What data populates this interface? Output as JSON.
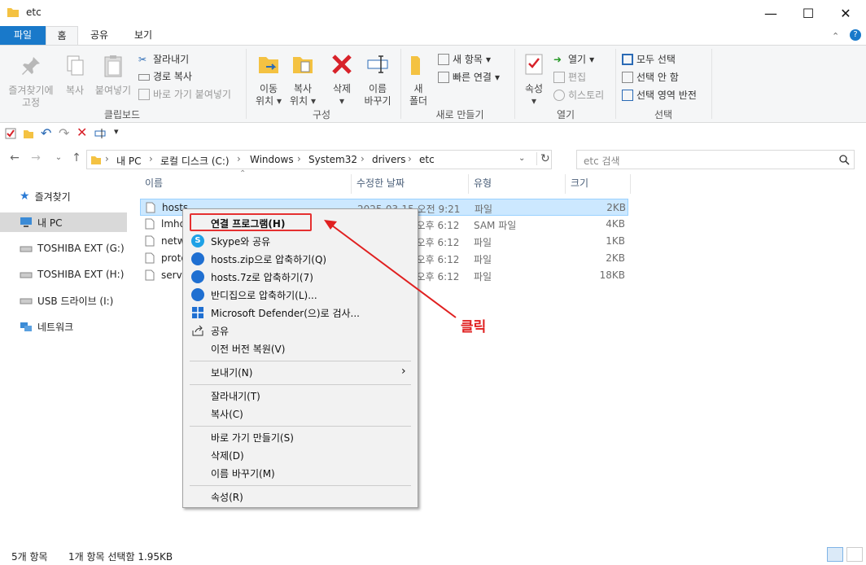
{
  "window": {
    "title": "etc"
  },
  "tabs": [
    {
      "label": "파일"
    },
    {
      "label": "홈"
    },
    {
      "label": "공유"
    },
    {
      "label": "보기"
    }
  ],
  "ribbon": {
    "clipboard": {
      "pin_label_1": "즐겨찾기에",
      "pin_label_2": "고정",
      "copy_label": "복사",
      "paste_label": "붙여넣기",
      "cut_label": "잘라내기",
      "copy_path_label": "경로 복사",
      "paste_shortcut_label": "바로 가기 붙여넣기",
      "group_label": "클립보드"
    },
    "organize": {
      "move_1": "이동",
      "move_2": "위치",
      "copyto_1": "복사",
      "copyto_2": "위치",
      "delete_label": "삭제",
      "rename_1": "이름",
      "rename_2": "바꾸기",
      "group_label": "구성"
    },
    "new": {
      "folder_1": "새",
      "folder_2": "폴더",
      "new_item_label": "새 항목",
      "easy_access_label": "빠른 연결",
      "group_label": "새로 만들기"
    },
    "open": {
      "properties_label": "속성",
      "open_label": "열기",
      "edit_label": "편집",
      "history_label": "히스토리",
      "group_label": "열기"
    },
    "select": {
      "select_all_label": "모두 선택",
      "select_none_label": "선택 안 함",
      "invert_label": "선택 영역 반전",
      "group_label": "선택"
    }
  },
  "address": {
    "crumbs": [
      "내 PC",
      "로컬 디스크 (C:)",
      "Windows",
      "System32",
      "drivers",
      "etc"
    ],
    "search_placeholder": "etc 검색"
  },
  "nav_pane": [
    {
      "label": "즐겨찾기"
    },
    {
      "label": "내 PC"
    },
    {
      "label": "TOSHIBA EXT (G:)"
    },
    {
      "label": "TOSHIBA EXT (H:)"
    },
    {
      "label": "USB 드라이브 (I:)"
    },
    {
      "label": "네트워크"
    }
  ],
  "columns": {
    "name": "이름",
    "date": "수정한 날짜",
    "type": "유형",
    "size": "크기"
  },
  "files": [
    {
      "name": "hosts",
      "date": "2025-03-15 오전 9:21",
      "type": "파일",
      "size": "2KB"
    },
    {
      "name": "lmhosts.sam",
      "date": "2019-12-07 오후 6:12",
      "type": "SAM 파일",
      "size": "4KB"
    },
    {
      "name": "networks",
      "date": "2019-12-07 오후 6:12",
      "type": "파일",
      "size": "1KB"
    },
    {
      "name": "protocol",
      "date": "2019-12-07 오후 6:12",
      "type": "파일",
      "size": "2KB"
    },
    {
      "name": "services",
      "date": "2019-12-07 오후 6:12",
      "type": "파일",
      "size": "18KB"
    }
  ],
  "context_menu": {
    "open_with": "연결 프로그램(H)",
    "skype_share": "Skype와 공유",
    "zip": "hosts.zip으로 압축하기(Q)",
    "sevenz": "hosts.7z로 압축하기(7)",
    "bandizip": "반디집으로 압축하기(L)...",
    "defender": "Microsoft Defender(으)로 검사...",
    "share": "공유",
    "restore": "이전 버전 복원(V)",
    "send_to": "보내기(N)",
    "cut": "잘라내기(T)",
    "copy": "복사(C)",
    "shortcut": "바로 가기 만들기(S)",
    "delete": "삭제(D)",
    "rename": "이름 바꾸기(M)",
    "properties": "속성(R)"
  },
  "annotation": {
    "text": "클릭",
    "color": "#e02020"
  },
  "status": {
    "count": "5개 항목",
    "selected": "1개 항목 선택함 1.95KB"
  },
  "colors": {
    "accent": "#1979ca",
    "selection": "#cce8ff"
  }
}
